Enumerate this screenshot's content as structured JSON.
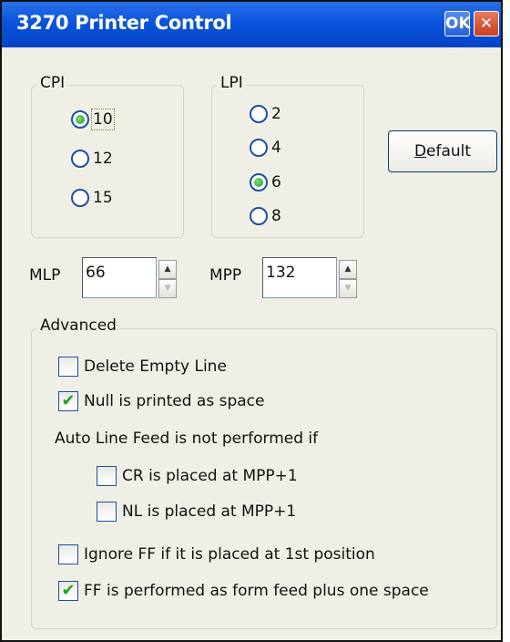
{
  "window": {
    "title": "3270 Printer Control",
    "ok_label": "OK",
    "close_label": "✕"
  },
  "cpi": {
    "label": "CPI",
    "options": [
      {
        "label": "10",
        "selected": true
      },
      {
        "label": "12",
        "selected": false
      },
      {
        "label": "15",
        "selected": false
      }
    ]
  },
  "lpi": {
    "label": "LPI",
    "options": [
      {
        "label": "2",
        "selected": false
      },
      {
        "label": "4",
        "selected": false
      },
      {
        "label": "6",
        "selected": true
      },
      {
        "label": "8",
        "selected": false
      }
    ]
  },
  "default_button": {
    "prefix": "D",
    "rest": "efault"
  },
  "mlp": {
    "label": "MLP",
    "value": "66"
  },
  "mpp": {
    "label": "MPP",
    "value": "132"
  },
  "spin_icons": {
    "up": "▲",
    "down": "▼"
  },
  "advanced": {
    "label": "Advanced",
    "delete_empty_line": {
      "label": "Delete Empty Line",
      "checked": false
    },
    "null_as_space": {
      "label": "Null is printed as space",
      "checked": true
    },
    "auto_line_feed_note": "Auto Line Feed is not performed if",
    "cr_at_mpp": {
      "label": "CR is placed at MPP+1",
      "checked": false
    },
    "nl_at_mpp": {
      "label": "NL is placed at MPP+1",
      "checked": false
    },
    "ignore_ff": {
      "label": "Ignore FF if it is placed at 1st position",
      "checked": false
    },
    "ff_form_feed": {
      "label": "FF is performed as form feed plus one space",
      "checked": true
    }
  },
  "check_glyph": "✔"
}
